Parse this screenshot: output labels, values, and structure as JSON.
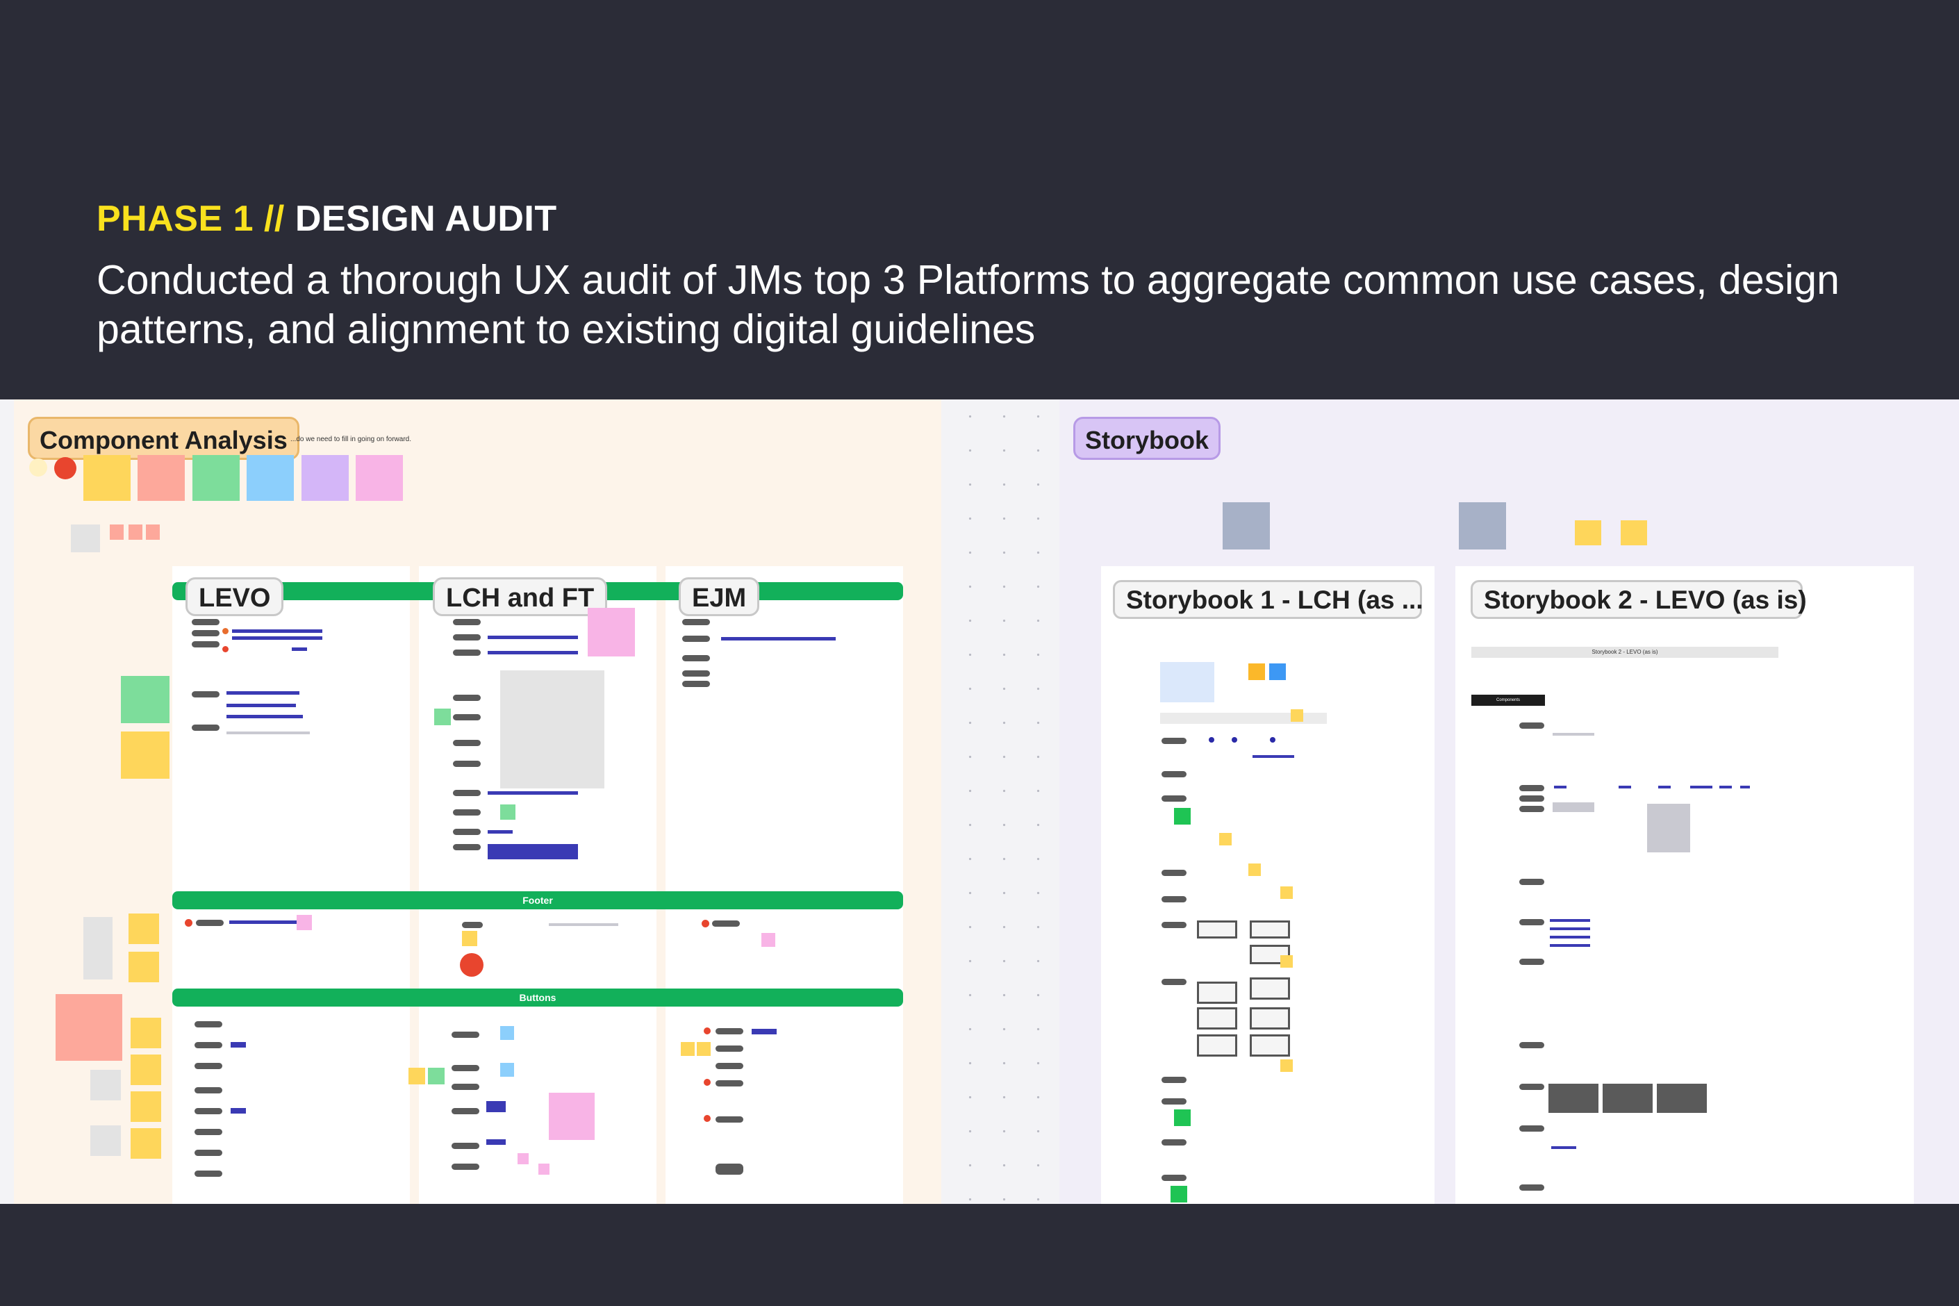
{
  "header": {
    "phase_label": "PHASE 1 //",
    "phase_title": "DESIGN AUDIT",
    "description": "Conducted a thorough UX audit of JMs top 3 Platforms to aggregate common use cases, design patterns, and alignment to existing digital guidelines"
  },
  "board": {
    "component_analysis": {
      "title": "Component Analysis",
      "subtitle": "...do we need to fill in going on forward.",
      "columns": [
        {
          "label": "LEVO"
        },
        {
          "label": "LCH and FT"
        },
        {
          "label": "EJM"
        }
      ],
      "footer_label": "Footer",
      "buttons_label": "Buttons"
    },
    "storybook": {
      "title": "Storybook",
      "frames": [
        {
          "label": "Storybook 1 - LCH (as ..."
        },
        {
          "label": "Storybook 2 - LEVO (as is)"
        }
      ],
      "frame2_heading": "Storybook 2 - LEVO (as is)",
      "frame2_tag": "Components"
    }
  },
  "colors": {
    "background": "#2b2c37",
    "accent_yellow": "#f9e11e",
    "bar_green": "#12b05a",
    "component_section": "#fdf4ea",
    "storybook_section": "#f1eef8",
    "link_blue": "#3a3ab4"
  }
}
